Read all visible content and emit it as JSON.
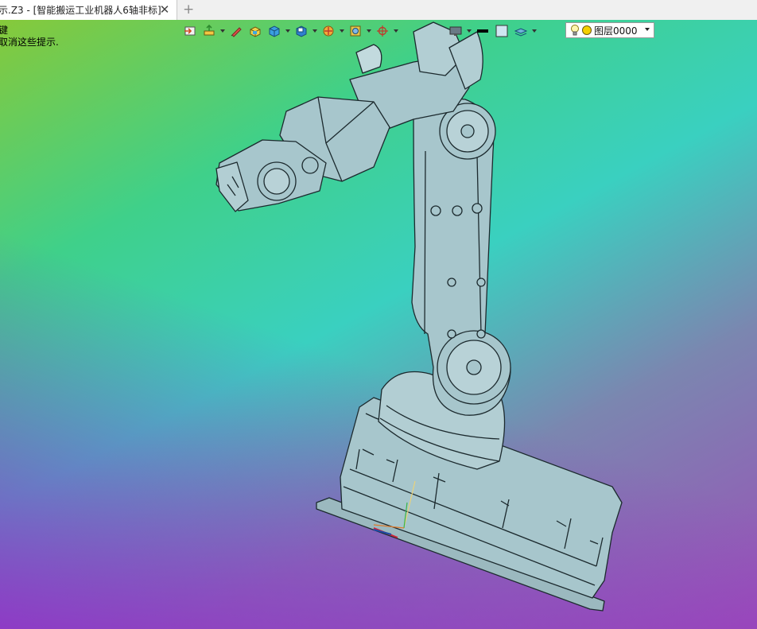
{
  "tab": {
    "title": "示.Z3 - [智能搬运工业机器人6轴非标]",
    "close_symbol": "✕",
    "add_symbol": "+"
  },
  "hints": {
    "line1": "键",
    "line2": "取消这些提示."
  },
  "toolbar": {
    "icons": [
      "import-icon",
      "align-icon",
      "pencil-icon",
      "cube-yellow-icon",
      "cube-blue-icon",
      "view-cube-icon",
      "section-icon",
      "render-mode-icon",
      "crosshair-icon",
      "display-icon",
      "line-color-icon",
      "fill-color-icon",
      "layer-stack-icon"
    ]
  },
  "layer": {
    "value": "图层0000",
    "bulb_color": "#f3c600",
    "dot_color": "#f5d000"
  },
  "colors": {
    "model_fill": "#a7c6cc",
    "model_stroke": "#1c2a2e"
  }
}
